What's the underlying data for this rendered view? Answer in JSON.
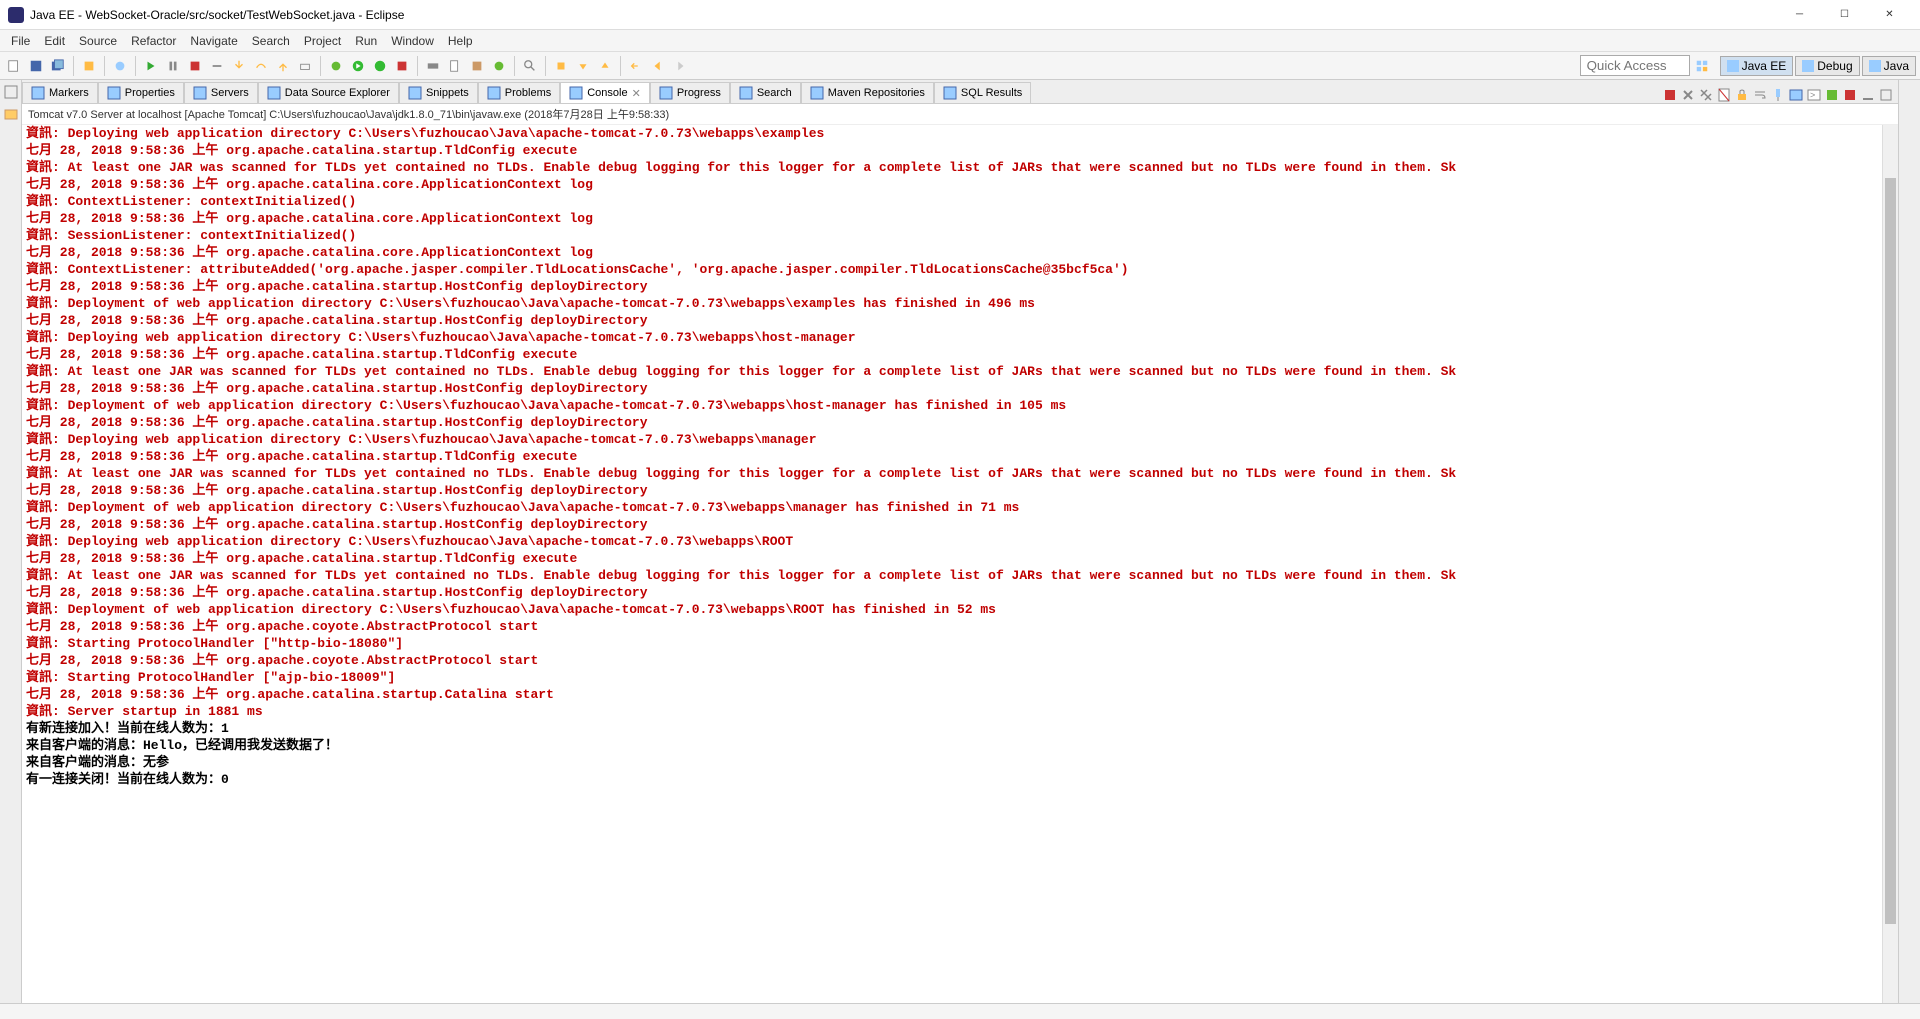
{
  "window": {
    "title": "Java EE - WebSocket-Oracle/src/socket/TestWebSocket.java - Eclipse"
  },
  "menu": [
    "File",
    "Edit",
    "Source",
    "Refactor",
    "Navigate",
    "Search",
    "Project",
    "Run",
    "Window",
    "Help"
  ],
  "quick_access": "Quick Access",
  "perspectives": [
    {
      "label": "Java EE",
      "active": true
    },
    {
      "label": "Debug",
      "active": false
    },
    {
      "label": "Java",
      "active": false
    }
  ],
  "view_tabs": [
    {
      "label": "Markers",
      "icon": "markers"
    },
    {
      "label": "Properties",
      "icon": "properties"
    },
    {
      "label": "Servers",
      "icon": "servers"
    },
    {
      "label": "Data Source Explorer",
      "icon": "datasource"
    },
    {
      "label": "Snippets",
      "icon": "snippets"
    },
    {
      "label": "Problems",
      "icon": "problems"
    },
    {
      "label": "Console",
      "icon": "console",
      "active": true,
      "closable": true
    },
    {
      "label": "Progress",
      "icon": "progress"
    },
    {
      "label": "Search",
      "icon": "search"
    },
    {
      "label": "Maven Repositories",
      "icon": "maven"
    },
    {
      "label": "SQL Results",
      "icon": "sql"
    }
  ],
  "console": {
    "header": "Tomcat v7.0 Server at localhost [Apache Tomcat] C:\\Users\\fuzhoucao\\Java\\jdk1.8.0_71\\bin\\javaw.exe (2018年7月28日 上午9:58:33)",
    "lines": [
      {
        "t": "資訊: Deploying web application directory C:\\Users\\fuzhoucao\\Java\\apache-tomcat-7.0.73\\webapps\\examples",
        "c": "red"
      },
      {
        "t": "七月 28, 2018 9:58:36 上午 org.apache.catalina.startup.TldConfig execute",
        "c": "red"
      },
      {
        "t": "資訊: At least one JAR was scanned for TLDs yet contained no TLDs. Enable debug logging for this logger for a complete list of JARs that were scanned but no TLDs were found in them. Sk",
        "c": "red"
      },
      {
        "t": "七月 28, 2018 9:58:36 上午 org.apache.catalina.core.ApplicationContext log",
        "c": "red"
      },
      {
        "t": "資訊: ContextListener: contextInitialized()",
        "c": "red"
      },
      {
        "t": "七月 28, 2018 9:58:36 上午 org.apache.catalina.core.ApplicationContext log",
        "c": "red"
      },
      {
        "t": "資訊: SessionListener: contextInitialized()",
        "c": "red"
      },
      {
        "t": "七月 28, 2018 9:58:36 上午 org.apache.catalina.core.ApplicationContext log",
        "c": "red"
      },
      {
        "t": "資訊: ContextListener: attributeAdded('org.apache.jasper.compiler.TldLocationsCache', 'org.apache.jasper.compiler.TldLocationsCache@35bcf5ca')",
        "c": "red"
      },
      {
        "t": "七月 28, 2018 9:58:36 上午 org.apache.catalina.startup.HostConfig deployDirectory",
        "c": "red"
      },
      {
        "t": "資訊: Deployment of web application directory C:\\Users\\fuzhoucao\\Java\\apache-tomcat-7.0.73\\webapps\\examples has finished in 496 ms",
        "c": "red"
      },
      {
        "t": "七月 28, 2018 9:58:36 上午 org.apache.catalina.startup.HostConfig deployDirectory",
        "c": "red"
      },
      {
        "t": "資訊: Deploying web application directory C:\\Users\\fuzhoucao\\Java\\apache-tomcat-7.0.73\\webapps\\host-manager",
        "c": "red"
      },
      {
        "t": "七月 28, 2018 9:58:36 上午 org.apache.catalina.startup.TldConfig execute",
        "c": "red"
      },
      {
        "t": "資訊: At least one JAR was scanned for TLDs yet contained no TLDs. Enable debug logging for this logger for a complete list of JARs that were scanned but no TLDs were found in them. Sk",
        "c": "red"
      },
      {
        "t": "七月 28, 2018 9:58:36 上午 org.apache.catalina.startup.HostConfig deployDirectory",
        "c": "red"
      },
      {
        "t": "資訊: Deployment of web application directory C:\\Users\\fuzhoucao\\Java\\apache-tomcat-7.0.73\\webapps\\host-manager has finished in 105 ms",
        "c": "red"
      },
      {
        "t": "七月 28, 2018 9:58:36 上午 org.apache.catalina.startup.HostConfig deployDirectory",
        "c": "red"
      },
      {
        "t": "資訊: Deploying web application directory C:\\Users\\fuzhoucao\\Java\\apache-tomcat-7.0.73\\webapps\\manager",
        "c": "red"
      },
      {
        "t": "七月 28, 2018 9:58:36 上午 org.apache.catalina.startup.TldConfig execute",
        "c": "red"
      },
      {
        "t": "資訊: At least one JAR was scanned for TLDs yet contained no TLDs. Enable debug logging for this logger for a complete list of JARs that were scanned but no TLDs were found in them. Sk",
        "c": "red"
      },
      {
        "t": "七月 28, 2018 9:58:36 上午 org.apache.catalina.startup.HostConfig deployDirectory",
        "c": "red"
      },
      {
        "t": "資訊: Deployment of web application directory C:\\Users\\fuzhoucao\\Java\\apache-tomcat-7.0.73\\webapps\\manager has finished in 71 ms",
        "c": "red"
      },
      {
        "t": "七月 28, 2018 9:58:36 上午 org.apache.catalina.startup.HostConfig deployDirectory",
        "c": "red"
      },
      {
        "t": "資訊: Deploying web application directory C:\\Users\\fuzhoucao\\Java\\apache-tomcat-7.0.73\\webapps\\ROOT",
        "c": "red"
      },
      {
        "t": "七月 28, 2018 9:58:36 上午 org.apache.catalina.startup.TldConfig execute",
        "c": "red"
      },
      {
        "t": "資訊: At least one JAR was scanned for TLDs yet contained no TLDs. Enable debug logging for this logger for a complete list of JARs that were scanned but no TLDs were found in them. Sk",
        "c": "red"
      },
      {
        "t": "七月 28, 2018 9:58:36 上午 org.apache.catalina.startup.HostConfig deployDirectory",
        "c": "red"
      },
      {
        "t": "資訊: Deployment of web application directory C:\\Users\\fuzhoucao\\Java\\apache-tomcat-7.0.73\\webapps\\ROOT has finished in 52 ms",
        "c": "red"
      },
      {
        "t": "七月 28, 2018 9:58:36 上午 org.apache.coyote.AbstractProtocol start",
        "c": "red"
      },
      {
        "t": "資訊: Starting ProtocolHandler [\"http-bio-18080\"]",
        "c": "red"
      },
      {
        "t": "七月 28, 2018 9:58:36 上午 org.apache.coyote.AbstractProtocol start",
        "c": "red"
      },
      {
        "t": "資訊: Starting ProtocolHandler [\"ajp-bio-18009\"]",
        "c": "red"
      },
      {
        "t": "七月 28, 2018 9:58:36 上午 org.apache.catalina.startup.Catalina start",
        "c": "red"
      },
      {
        "t": "資訊: Server startup in 1881 ms",
        "c": "red"
      },
      {
        "t": "有新连接加入！当前在线人数为：1",
        "c": "black"
      },
      {
        "t": "来自客户端的消息：Hello，已经调用我发送数据了！",
        "c": "black"
      },
      {
        "t": "来自客户端的消息：无参",
        "c": "black"
      },
      {
        "t": "有一连接关闭！当前在线人数为：0",
        "c": "black"
      }
    ]
  }
}
